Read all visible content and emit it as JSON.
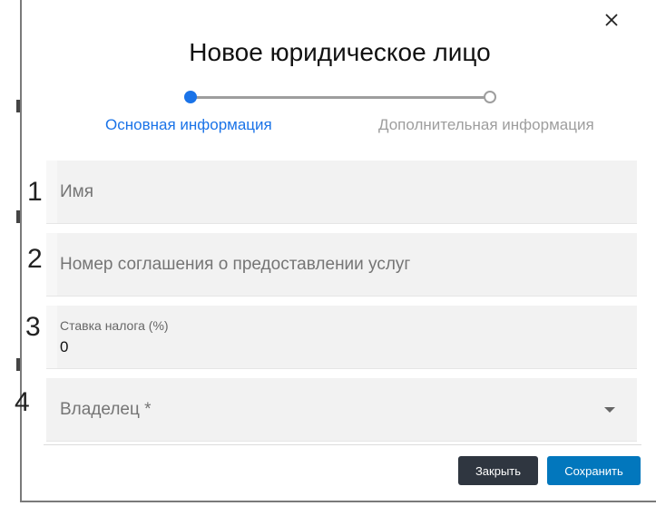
{
  "dialog": {
    "title": "Новое юридическое лицо",
    "close_icon": "close-icon"
  },
  "stepper": {
    "steps": [
      {
        "label": "Основная информация",
        "state": "active"
      },
      {
        "label": "Дополнительная информация",
        "state": "inactive"
      }
    ],
    "active_color": "#1a73e8",
    "inactive_color": "#9e9e9e"
  },
  "form": {
    "fields": [
      {
        "number": "1",
        "placeholder": "Имя"
      },
      {
        "number": "2",
        "placeholder": "Номер соглашения о предоставлении услуг"
      },
      {
        "number": "3",
        "label": "Ставка налога (%)",
        "value": "0"
      },
      {
        "number": "4",
        "placeholder": "Владелец *",
        "type": "select"
      }
    ]
  },
  "footer": {
    "close_label": "Закрыть",
    "save_label": "Сохранить",
    "close_color": "#2f3640",
    "save_color": "#0277bd"
  }
}
